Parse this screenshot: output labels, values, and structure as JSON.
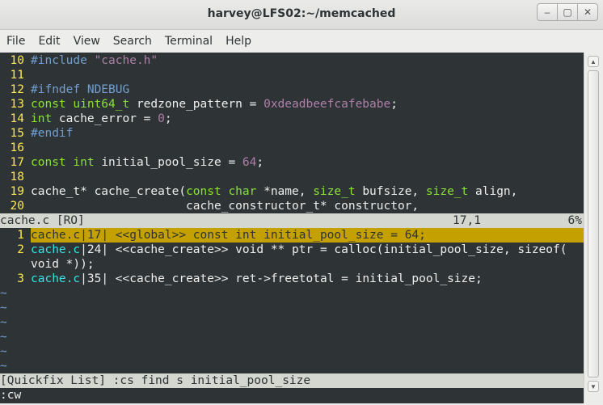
{
  "window": {
    "title": "harvey@LFS02:~/memcached",
    "btn_minimize": "–",
    "btn_maximize": "▢",
    "btn_close": "✕"
  },
  "menubar": [
    "File",
    "Edit",
    "View",
    "Search",
    "Terminal",
    "Help"
  ],
  "editor": {
    "lines": [
      {
        "n": "10",
        "parts": [
          [
            "pp",
            "#include "
          ],
          [
            "str",
            "\"cache.h\""
          ]
        ]
      },
      {
        "n": "11",
        "parts": []
      },
      {
        "n": "12",
        "parts": [
          [
            "pp",
            "#ifndef NDEBUG"
          ]
        ]
      },
      {
        "n": "13",
        "parts": [
          [
            "typ",
            "const uint64_t "
          ],
          [
            "plain",
            "redzone_pattern = "
          ],
          [
            "num",
            "0xdeadbeefcafebabe"
          ],
          [
            "plain",
            ";"
          ]
        ]
      },
      {
        "n": "14",
        "parts": [
          [
            "typ",
            "int "
          ],
          [
            "plain",
            "cache_error = "
          ],
          [
            "num",
            "0"
          ],
          [
            "plain",
            ";"
          ]
        ]
      },
      {
        "n": "15",
        "parts": [
          [
            "pp",
            "#endif"
          ]
        ]
      },
      {
        "n": "16",
        "parts": []
      },
      {
        "n": "17",
        "parts": [
          [
            "typ",
            "const int "
          ],
          [
            "plain",
            "initial_pool_size = "
          ],
          [
            "num",
            "64"
          ],
          [
            "plain",
            ";"
          ]
        ]
      },
      {
        "n": "18",
        "parts": []
      },
      {
        "n": "19",
        "parts": [
          [
            "plain",
            "cache_t* cache_create("
          ],
          [
            "typ",
            "const char "
          ],
          [
            "plain",
            "*name, "
          ],
          [
            "typ",
            "size_t "
          ],
          [
            "plain",
            "bufsize, "
          ],
          [
            "typ",
            "size_t "
          ],
          [
            "plain",
            "align,"
          ]
        ]
      },
      {
        "n": "20",
        "parts": [
          [
            "plain",
            "                      cache_constructor_t* constructor,"
          ]
        ]
      }
    ],
    "status_left": "cache.c [RO]",
    "status_pos": "17,1",
    "status_pct": "6%"
  },
  "quickfix": {
    "items": [
      {
        "n": "1",
        "file": "cache.c",
        "lnum": "17",
        "text": " <<global>> const int initial_pool_size = 64;",
        "selected": true
      },
      {
        "n": "2",
        "file": "cache.c",
        "lnum": "24",
        "text": " <<cache_create>> void ** ptr = calloc(initial_pool_size, sizeof(",
        "selected": false
      },
      {
        "n": "",
        "file": "",
        "lnum": "",
        "text": "void *));",
        "selected": false,
        "continuation": true
      },
      {
        "n": "3",
        "file": "cache.c",
        "lnum": "35",
        "text": " <<cache_create>> ret->freetotal = initial_pool_size;",
        "selected": false
      }
    ],
    "tildes": [
      "~",
      "~",
      "~",
      "~",
      "~",
      "~"
    ],
    "status": "[Quickfix List] :cs find s initial_pool_size"
  },
  "cmdline": ":cw"
}
